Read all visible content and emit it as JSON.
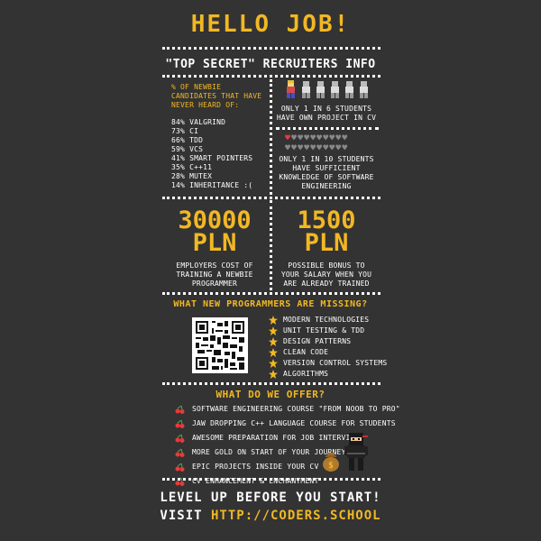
{
  "header": {
    "title": "HELLO JOB!",
    "subtitle": "\"TOP SECRET\" RECRUITERS INFO"
  },
  "newbie": {
    "heading": [
      "% OF NEWBIE",
      "CANDIDATES THAT HAVE",
      "NEVER HEARD OF:"
    ],
    "items": [
      "84% VALGRIND",
      "73% CI",
      "66% TDD",
      "59% VCS",
      "41% SMART POINTERS",
      "35% C++11",
      "28% MUTEX",
      "14% INHERITANCE :("
    ]
  },
  "project_stat": {
    "text": [
      "ONLY 1 IN 6 STUDENTS",
      "HAVE OWN PROJECT IN CV"
    ],
    "highlighted": 1,
    "total": 6
  },
  "knowledge_stat": {
    "text": [
      "ONLY 1 IN 10 STUDENTS",
      "HAVE SUFFICIENT",
      "KNOWLEDGE OF SOFTWARE",
      "ENGINEERING"
    ],
    "filled": 1,
    "total": 10
  },
  "cost": {
    "value": "30000",
    "unit": "PLN",
    "desc": [
      "EMPLOYERS COST OF",
      "TRAINING A NEWBIE",
      "PROGRAMMER"
    ]
  },
  "bonus": {
    "value": "1500",
    "unit": "PLN",
    "desc": [
      "POSSIBLE BONUS TO",
      "YOUR SALARY WHEN YOU",
      "ARE ALREADY TRAINED"
    ]
  },
  "missing": {
    "heading": "WHAT NEW PROGRAMMERS ARE MISSING?",
    "items": [
      "MODERN TECHNOLOGIES",
      "UNIT TESTING & TDD",
      "DESIGN PATTERNS",
      "CLEAN CODE",
      "VERSION CONTROL SYSTEMS",
      "ALGORITHMS"
    ]
  },
  "offer": {
    "heading": "WHAT DO WE OFFER?",
    "items": [
      "SOFTWARE ENGINEERING COURSE \"FROM NOOB TO PRO\"",
      "JAW DROPPING C++ LANGUAGE COURSE FOR STUDENTS",
      "AWESOME PREPARATION FOR JOB INTERVIEWS",
      "MORE GOLD ON START OF YOUR JOURNEY",
      "EPIC PROJECTS INSIDE YOUR CV",
      "CV ENHANCEMENT & ENCHANTMENT"
    ]
  },
  "footer": {
    "line1": "LEVEL UP BEFORE YOU START!",
    "visit": "VISIT",
    "url": "HTTP://CODERS.SCHOOL"
  },
  "icons": {
    "bullet": "star-icon",
    "offer_bullet": "cherry-icon",
    "heart": "heart-icon",
    "person": "person-icon",
    "ninja": "ninja-icon",
    "moneybag": "money-bag-icon"
  },
  "colors": {
    "background": "#333333",
    "accent": "#f2b824",
    "text": "#ffffff",
    "heart_filled": "#e83a3a",
    "heart_empty": "#888888"
  }
}
